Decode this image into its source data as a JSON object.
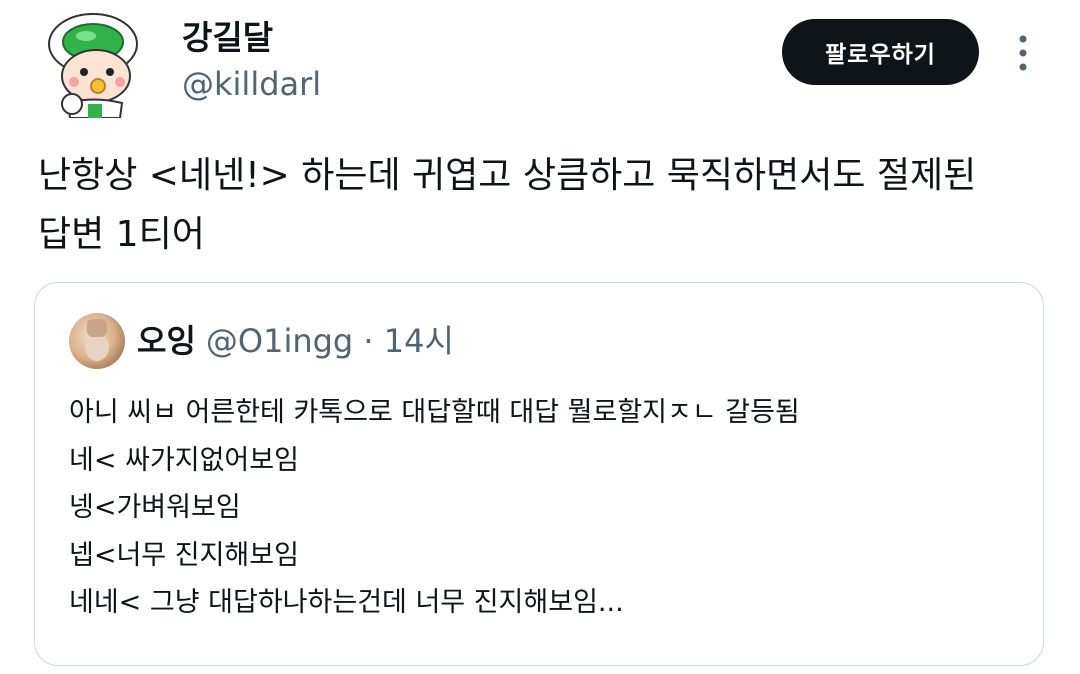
{
  "author": {
    "display_name": "강길달",
    "handle": "@killdarl",
    "avatar_icon": "cartoon-character-avatar"
  },
  "follow_button": {
    "label": "팔로우하기",
    "bg_color": "#0f1419",
    "text_color": "#ffffff"
  },
  "more_menu": {
    "icon": "more-vertical-icon"
  },
  "tweet": {
    "text": "난항상 <네넨!> 하는데 귀엽고 상큼하고 묵직하면서도 절제된\n답변 1티어"
  },
  "quoted_tweet": {
    "display_name": "오잉",
    "handle": "@O1ingg",
    "separator": "·",
    "time": "14시",
    "avatar_icon": "photo-avatar",
    "lines": [
      "아니 씨ㅂ 어른한테 카톡으로 대답할때 대답 뭘로할지ㅈㄴ 갈등됨",
      "네< 싸가지없어보임",
      "넹<가벼워보임",
      "넵<너무 진지해보임",
      "네네< 그냥 대답하나하는건데 너무 진지해보임..."
    ]
  },
  "colors": {
    "text_primary": "#0f1419",
    "text_secondary": "#536471",
    "border": "#cfd9de"
  }
}
